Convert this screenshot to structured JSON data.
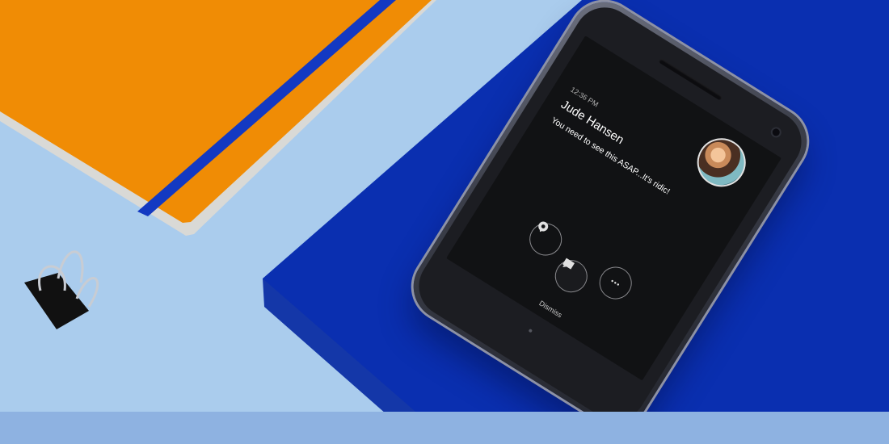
{
  "colors": {
    "background": "#aacced",
    "notebook_orange": "#f08c05",
    "strap_blue": "#1339c2",
    "paper_blue": "#0a2fb0",
    "bottom_band": "#8eb2e1",
    "screen": "#111214"
  },
  "notification": {
    "time": "12:36 PM",
    "sender": "Jude Hansen",
    "message": "You need to see this ASAP...It's ridic!",
    "avatar_icon": "contact-photo",
    "actions": [
      {
        "name": "reply",
        "icon": "reply-icon"
      },
      {
        "name": "open",
        "icon": "message-icon"
      },
      {
        "name": "more",
        "icon": "more-icon",
        "glyph": "•••"
      }
    ],
    "dismiss_label": "Dismiss"
  }
}
